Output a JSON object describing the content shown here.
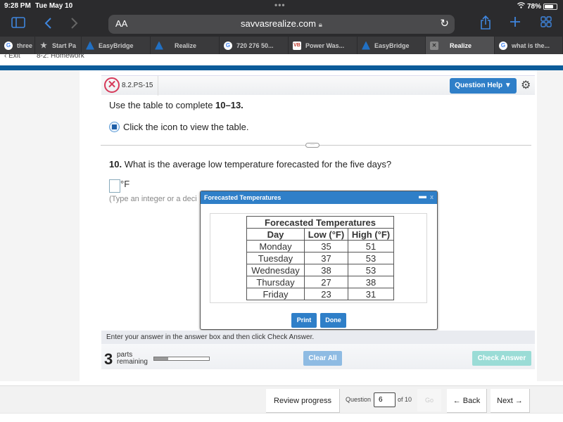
{
  "statusbar": {
    "time": "9:28 PM",
    "date": "Tue May 10",
    "battery": "78%",
    "battery_level": 0.78
  },
  "browser": {
    "text_size_label": "AA",
    "url": "savvasrealize.com",
    "tabs": [
      {
        "icon": "google-icon",
        "label": "three",
        "active": false
      },
      {
        "icon": "star-icon",
        "label": "Start Pa",
        "active": false
      },
      {
        "icon": "easybridge-icon",
        "label": "EasyBridge",
        "active": false
      },
      {
        "icon": "realize-icon",
        "label": "Realize",
        "active": false
      },
      {
        "icon": "google-icon",
        "label": "720 276 50...",
        "active": false
      },
      {
        "icon": "vb-icon",
        "label": "Power Was...",
        "active": false
      },
      {
        "icon": "easybridge-icon",
        "label": "EasyBridge",
        "active": false
      },
      {
        "icon": "close-tab-icon",
        "label": "Realize",
        "active": true
      },
      {
        "icon": "google-icon",
        "label": "what is the...",
        "active": false
      }
    ]
  },
  "page_header": {
    "exit_label": "Exit",
    "breadcrumb": "8-2: Homework"
  },
  "question": {
    "id": "8.2.PS-15",
    "help_label": "Question Help",
    "instruction_prefix": "Use the table to complete ",
    "instruction_bold": "10–13.",
    "view_table_text": "Click the icon to view the table.",
    "number": "10.",
    "text": "What is the average low temperature forecasted for the five days?",
    "answer_value": "",
    "unit": "°F",
    "hint": "(Type an integer or a deci"
  },
  "dialog": {
    "title": "Forecasted Temperatures",
    "minimize": "–",
    "close": "x",
    "table": {
      "caption": "Forecasted Temperatures",
      "headers": [
        "Day",
        "Low (°F)",
        "High (°F)"
      ],
      "rows": [
        [
          "Monday",
          "35",
          "51"
        ],
        [
          "Tuesday",
          "37",
          "53"
        ],
        [
          "Wednesday",
          "38",
          "53"
        ],
        [
          "Thursday",
          "27",
          "38"
        ],
        [
          "Friday",
          "23",
          "31"
        ]
      ]
    },
    "print_label": "Print",
    "done_label": "Done"
  },
  "footer": {
    "instruction": "Enter your answer in the answer box and then click Check Answer.",
    "parts_count": "3",
    "parts_label_1": "parts",
    "parts_label_2": "remaining",
    "parts_progress": 0.25,
    "clear_all_label": "Clear All",
    "check_answer_label": "Check Answer"
  },
  "nav": {
    "review_label": "Review progress",
    "question_label": "Question",
    "question_value": "6",
    "of_label": "of 10",
    "go_label": "Go",
    "back_label": "← Back",
    "next_label": "Next →"
  }
}
